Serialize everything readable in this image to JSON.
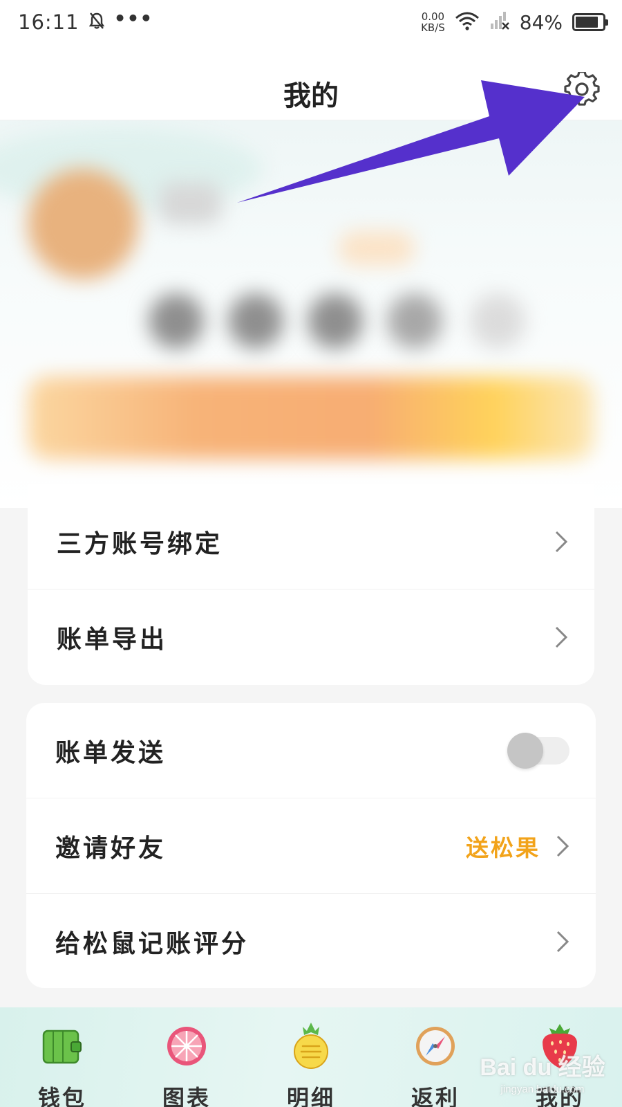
{
  "status_bar": {
    "time": "16:11",
    "more": "•••",
    "net_speed_value": "0.00",
    "net_speed_unit": "KB/S",
    "battery_percent": "84%",
    "battery_level": 0.84
  },
  "header": {
    "title": "我的",
    "settings_icon": "gear-icon"
  },
  "menu_card_1": {
    "items": [
      {
        "label": "三方账号绑定",
        "icon": "chevron-right-icon"
      },
      {
        "label": "账单导出",
        "icon": "chevron-right-icon"
      }
    ]
  },
  "menu_card_2": {
    "items": [
      {
        "label": "账单发送",
        "toggle_on": false
      },
      {
        "label": "邀请好友",
        "extra": "送松果",
        "icon": "chevron-right-icon"
      },
      {
        "label": "给松鼠记账评分",
        "icon": "chevron-right-icon"
      }
    ]
  },
  "bottom_nav": {
    "items": [
      {
        "label": "钱包",
        "icon": "wallet-icon"
      },
      {
        "label": "图表",
        "icon": "grapefruit-chart-icon"
      },
      {
        "label": "明细",
        "icon": "pineapple-icon"
      },
      {
        "label": "返利",
        "icon": "compass-icon"
      },
      {
        "label": "我的",
        "icon": "strawberry-icon"
      }
    ]
  },
  "watermark": {
    "logo": "Bai du 经验",
    "url": "jingyan.baidu.com"
  },
  "colors": {
    "accent_orange": "#f2a31a",
    "arrow": "#5530cc",
    "nav_background": "#d8f1ec"
  }
}
